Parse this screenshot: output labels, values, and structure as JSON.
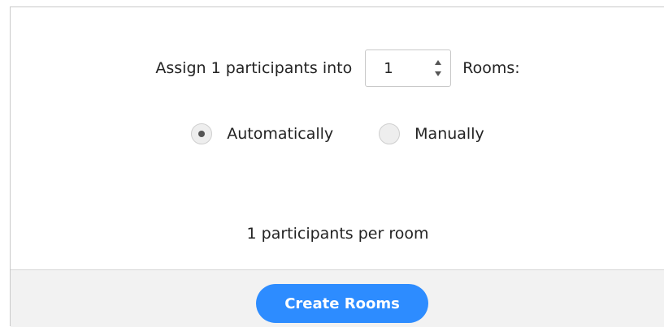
{
  "assign": {
    "prefix_label": "Assign 1 participants into",
    "rooms_value": "1",
    "suffix_label": "Rooms:"
  },
  "mode": {
    "selected": "Automatically",
    "options": [
      {
        "label": "Automatically",
        "checked": true
      },
      {
        "label": "Manually",
        "checked": false
      }
    ]
  },
  "summary": {
    "per_room_label": "1 participants per room"
  },
  "footer": {
    "create_button_label": "Create Rooms"
  },
  "colors": {
    "primary_button": "#2d8cff",
    "footer_background": "#f2f2f2"
  },
  "icons": [
    "stepper-up-icon",
    "stepper-down-icon",
    "radio-checked-icon",
    "radio-unchecked-icon"
  ]
}
